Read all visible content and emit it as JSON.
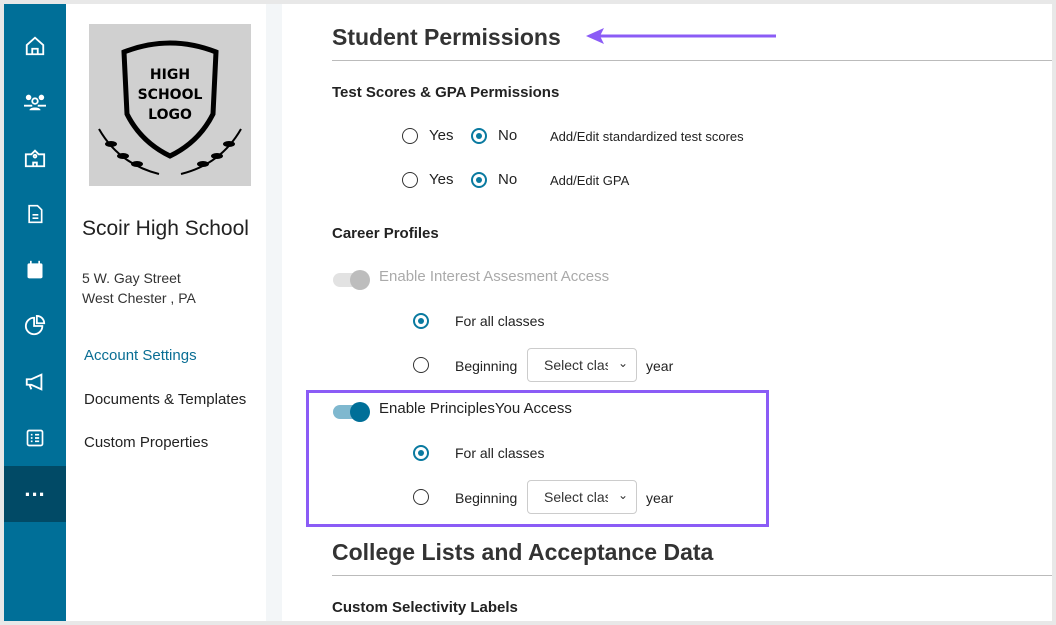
{
  "nav": {
    "items": [
      "home",
      "users",
      "school",
      "document",
      "calendar",
      "analytics",
      "megaphone",
      "checklist",
      "more"
    ],
    "active": "more"
  },
  "school": {
    "logo_text": "HIGH SCHOOL LOGO",
    "name": "Scoir High School",
    "address1": "5 W. Gay Street",
    "address2": "West Chester , PA"
  },
  "settings_menu": [
    {
      "label": "Account Settings",
      "active": true
    },
    {
      "label": "Documents & Templates"
    },
    {
      "label": "Custom Properties"
    }
  ],
  "main": {
    "title": "Student Permissions",
    "test_scores": {
      "heading": "Test Scores & GPA Permissions",
      "yes": "Yes",
      "no": "No",
      "rows": [
        {
          "label": "Add/Edit standardized test scores",
          "value": "No"
        },
        {
          "label": "Add/Edit GPA",
          "value": "No"
        }
      ]
    },
    "career": {
      "heading": "Career Profiles",
      "interest": {
        "label": "Enable Interest Assesment Access",
        "enabled": true,
        "disabled": true,
        "all_classes": "For all classes",
        "beginning": "Beginning",
        "select_placeholder": "Select class",
        "year": "year",
        "selected": "For all classes"
      },
      "principles": {
        "label": "Enable PrinciplesYou Access",
        "enabled": true,
        "all_classes": "For all classes",
        "beginning": "Beginning",
        "select_placeholder": "Select class",
        "year": "year",
        "selected": "For all classes"
      }
    },
    "college": {
      "title": "College Lists and Acceptance Data",
      "sub": "Custom Selectivity Labels"
    }
  },
  "colors": {
    "nav": "#006f98",
    "accent": "#0a7aa0",
    "annotation": "#8b5cf6"
  }
}
